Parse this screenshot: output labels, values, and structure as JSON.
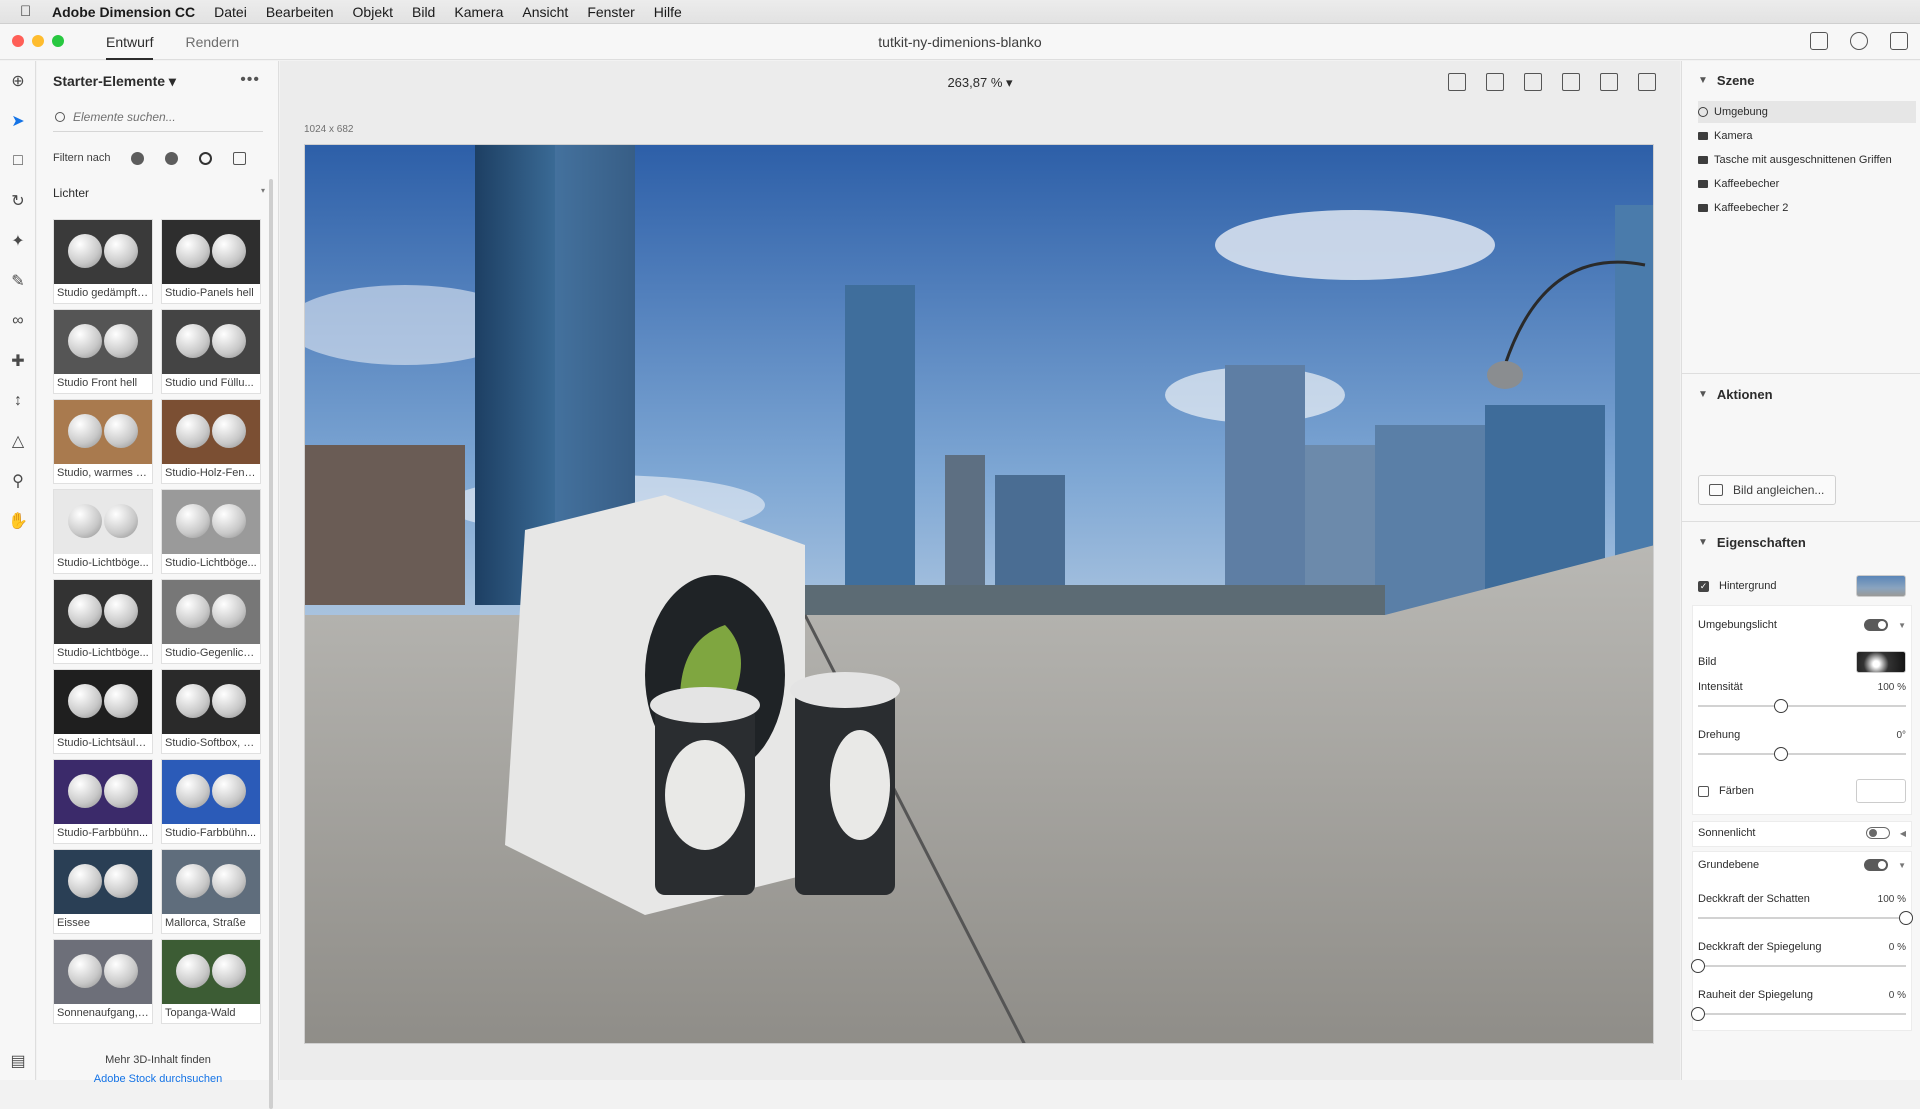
{
  "menubar": {
    "app": "Adobe Dimension CC",
    "items": [
      "Datei",
      "Bearbeiten",
      "Objekt",
      "Bild",
      "Kamera",
      "Ansicht",
      "Fenster",
      "Hilfe"
    ]
  },
  "titlebar": {
    "tabs": [
      "Entwurf",
      "Rendern"
    ],
    "active_tab": "Entwurf",
    "document": "tutkit-ny-dimenions-blanko"
  },
  "assets": {
    "title": "Starter-Elemente",
    "search_placeholder": "Elemente suchen...",
    "filter_label": "Filtern nach",
    "category": "Lichter",
    "items": [
      "Studio gedämpft ...",
      "Studio-Panels hell",
      "Studio Front hell",
      "Studio und Füllu...",
      "Studio, warmes F...",
      "Studio-Holz-Fens...",
      "Studio-Lichtböge...",
      "Studio-Lichtböge...",
      "Studio-Lichtböge...",
      "Studio-Gegenlich...",
      "Studio-Lichtsäule...",
      "Studio-Softbox, 3...",
      "Studio-Farbbühn...",
      "Studio-Farbbühn...",
      "Eissee",
      "Mallorca, Straße",
      "Sonnenaufgang, ...",
      "Topanga-Wald"
    ],
    "footer": "Mehr 3D-Inhalt finden",
    "footer_link": "Adobe Stock durchsuchen"
  },
  "canvas": {
    "zoom": "263,87 %",
    "dimensions": "1024 x 682"
  },
  "scene_panel": {
    "title": "Szene",
    "items": [
      "Umgebung",
      "Kamera",
      "Tasche mit ausgeschnittenen Griffen",
      "Kaffeebecher",
      "Kaffeebecher 2"
    ],
    "selected": "Umgebung"
  },
  "actions_panel": {
    "title": "Aktionen",
    "button": "Bild angleichen..."
  },
  "properties": {
    "title": "Eigenschaften",
    "background": "Hintergrund",
    "background_checked": true,
    "env_light": "Umgebungslicht",
    "env_light_on": true,
    "image": "Bild",
    "intensity_label": "Intensität",
    "intensity_value": "100 %",
    "intensity_level": 0.4,
    "rotation_label": "Drehung",
    "rotation_value": "0°",
    "rotation_level": 0.4,
    "tint_label": "Färben",
    "sunlight": "Sonnenlicht",
    "sunlight_on": false,
    "ground": "Grundebene",
    "ground_on": true,
    "shadow_opacity_label": "Deckkraft der Schatten",
    "shadow_opacity_value": "100 %",
    "shadow_opacity_level": 1.0,
    "reflection_opacity_label": "Deckkraft der Spiegelung",
    "reflection_opacity_value": "0 %",
    "reflection_opacity_level": 0.0,
    "reflection_roughness_label": "Rauheit der Spiegelung",
    "reflection_roughness_value": "0 %",
    "reflection_roughness_level": 0.0
  },
  "colors": {
    "accent": "#1473e6",
    "traffic_red": "#ff5f57",
    "traffic_yellow": "#febc2e",
    "traffic_green": "#28c840"
  }
}
